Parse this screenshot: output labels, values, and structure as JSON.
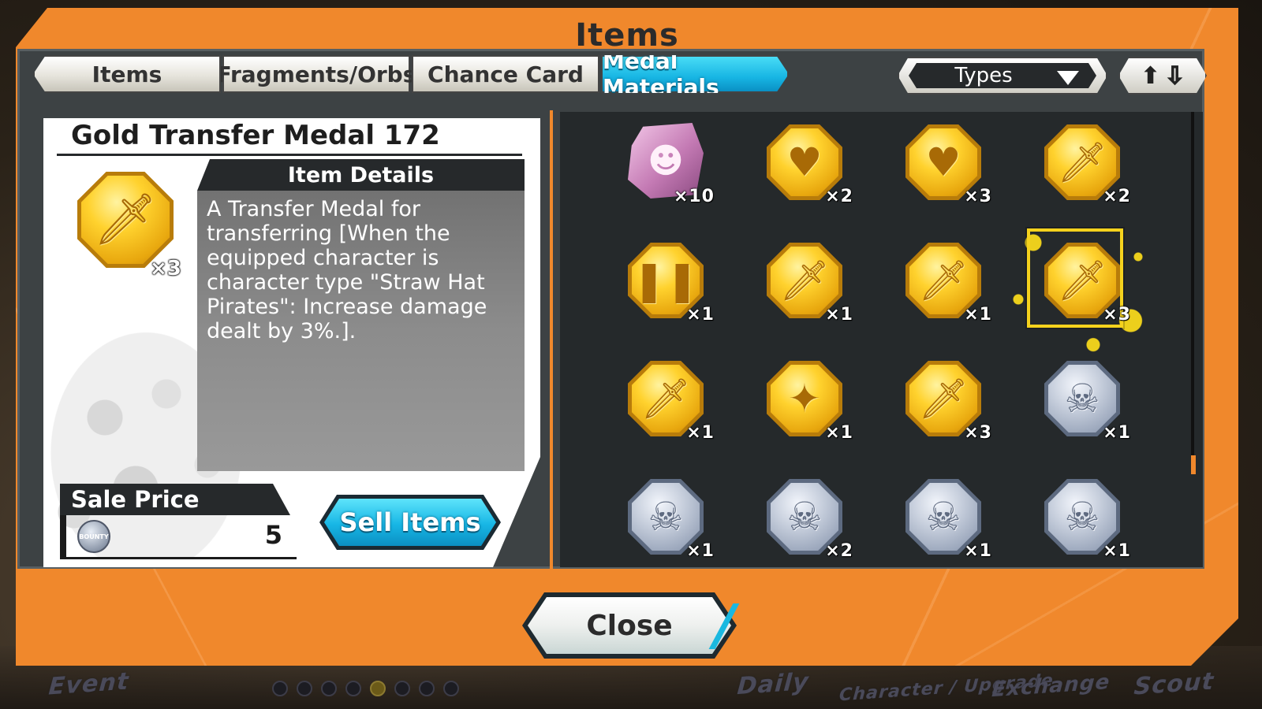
{
  "modal": {
    "title": "Items"
  },
  "tabs": [
    {
      "label": "Items",
      "active": false
    },
    {
      "label": "Fragments/Orbs",
      "active": false
    },
    {
      "label": "Chance Card",
      "active": false
    },
    {
      "label": "Medal Materials",
      "active": true
    }
  ],
  "filter": {
    "types_label": "Types",
    "sort_icons": [
      "arrow-up-icon",
      "arrow-down-icon"
    ]
  },
  "detail": {
    "item_name": "Gold Transfer Medal 172",
    "quantity": "×3",
    "icon": "sword-icon",
    "details_header": "Item Details",
    "description": "A Transfer Medal for transferring [When the equipped character is character type \"Straw Hat Pirates\": Increase damage dealt by 3%.].",
    "sale_price_label": "Sale Price",
    "sale_price_value": "5",
    "currency_icon": "bounty-coin-icon",
    "currency_text": "BOUNTY",
    "sell_button": "Sell Items"
  },
  "grid": [
    {
      "kind": "fragment",
      "icon": "character-fragment-icon",
      "qty": "×10"
    },
    {
      "kind": "gold",
      "icon": "heart-icon",
      "glyph": "♥",
      "qty": "×2"
    },
    {
      "kind": "gold",
      "icon": "heart-icon",
      "glyph": "♥",
      "qty": "×3"
    },
    {
      "kind": "gold",
      "icon": "sword-icon",
      "glyph": "🗡",
      "qty": "×2"
    },
    {
      "kind": "gold",
      "icon": "armor-icon",
      "glyph": "❚❚",
      "qty": "×1"
    },
    {
      "kind": "gold",
      "icon": "sword-icon",
      "glyph": "🗡",
      "qty": "×1"
    },
    {
      "kind": "gold",
      "icon": "sword-icon",
      "glyph": "🗡",
      "qty": "×1"
    },
    {
      "kind": "gold",
      "icon": "sword-icon",
      "glyph": "🗡",
      "qty": "×3",
      "selected": true
    },
    {
      "kind": "gold",
      "icon": "sword-icon",
      "glyph": "🗡",
      "qty": "×1"
    },
    {
      "kind": "gold",
      "icon": "star-sword-icon",
      "glyph": "✦",
      "qty": "×1"
    },
    {
      "kind": "gold",
      "icon": "sword-icon",
      "glyph": "🗡",
      "qty": "×3"
    },
    {
      "kind": "silver",
      "icon": "skull-icon",
      "glyph": "☠",
      "qty": "×1"
    },
    {
      "kind": "silver",
      "icon": "skull-icon",
      "glyph": "☠",
      "qty": "×1"
    },
    {
      "kind": "silver",
      "icon": "skull-icon",
      "glyph": "☠",
      "qty": "×2"
    },
    {
      "kind": "silver",
      "icon": "skull-icon",
      "glyph": "☠",
      "qty": "×1"
    },
    {
      "kind": "silver",
      "icon": "skull-icon",
      "glyph": "☠",
      "qty": "×1"
    }
  ],
  "close_button": "Close",
  "background_nav": [
    "Event",
    "Daily",
    "Character / Upgrade",
    "Exchange",
    "Scout"
  ],
  "colors": {
    "accent_orange": "#f0882c",
    "active_tab_cyan": "#17b5e3",
    "selected_yellow": "#f5d21d"
  }
}
